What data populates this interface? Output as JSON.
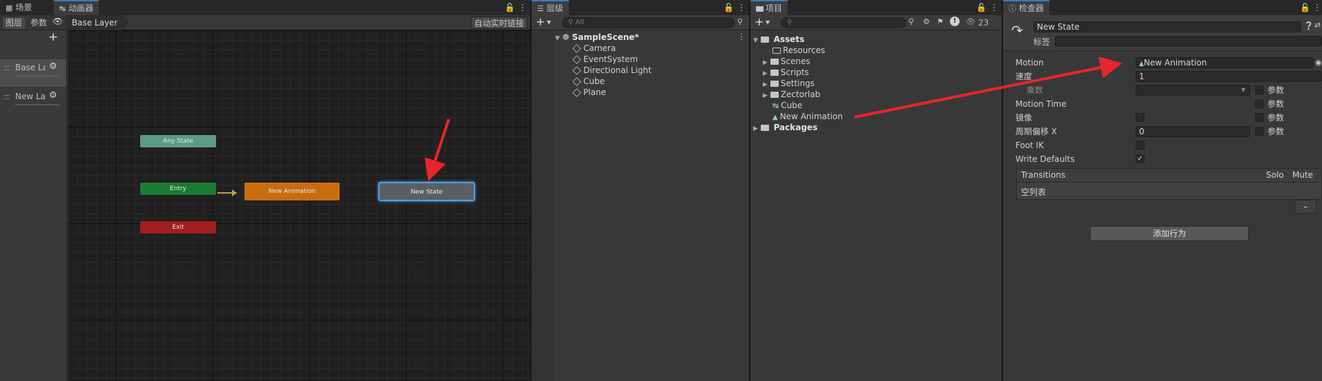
{
  "panels": {
    "scene_tab": "场景",
    "animator_tab": "动画器",
    "hierarchy_tab": "层级",
    "project_tab": "项目",
    "inspector_tab": "检查器"
  },
  "animator": {
    "left_tabs": [
      "图层",
      "参数"
    ],
    "layers": [
      "Base Layer",
      "New Layer"
    ],
    "breadcrumb": "Base Layer",
    "auto_live_link": "自动实时链接",
    "nodes": {
      "any_state": "Any State",
      "entry": "Entry",
      "exit": "Exit",
      "new_animation": "New Animation",
      "new_state": "New State"
    }
  },
  "hierarchy": {
    "search_placeholder": "All",
    "scene_name": "SampleScene*",
    "items": [
      "Camera",
      "EventSystem",
      "Directional Light",
      "Cube",
      "Plane"
    ]
  },
  "project": {
    "hidden_count": "23",
    "root": "Assets",
    "children": [
      "Resources",
      "Scenes",
      "Scripts",
      "Settings",
      "Zectorlab",
      "Cube",
      "New Animation"
    ],
    "packages": "Packages"
  },
  "inspector": {
    "state_name": "New State",
    "tag_label": "标签",
    "motion_label": "Motion",
    "motion_value": "New Animation",
    "speed_label": "速度",
    "speed_value": "1",
    "multiplier_label": "乘数",
    "param_label": "参数",
    "motion_time_label": "Motion Time",
    "mirror_label": "镜像",
    "cycle_offset_label": "周期偏移 X",
    "cycle_offset_value": "0",
    "foot_ik_label": "Foot IK",
    "write_defaults_label": "Write Defaults",
    "write_defaults_checked": true,
    "transitions_label": "Transitions",
    "solo_label": "Solo",
    "mute_label": "Mute",
    "empty_list": "空列表",
    "remove_symbol": "–",
    "add_behaviour": "添加行为"
  },
  "colors": {
    "any_state": "#5d9a89",
    "entry": "#1d7a33",
    "exit": "#a21d1d",
    "animation_state": "#c86d10",
    "selection": "#4ba2ea",
    "annotation_arrow": "#e8252b"
  }
}
